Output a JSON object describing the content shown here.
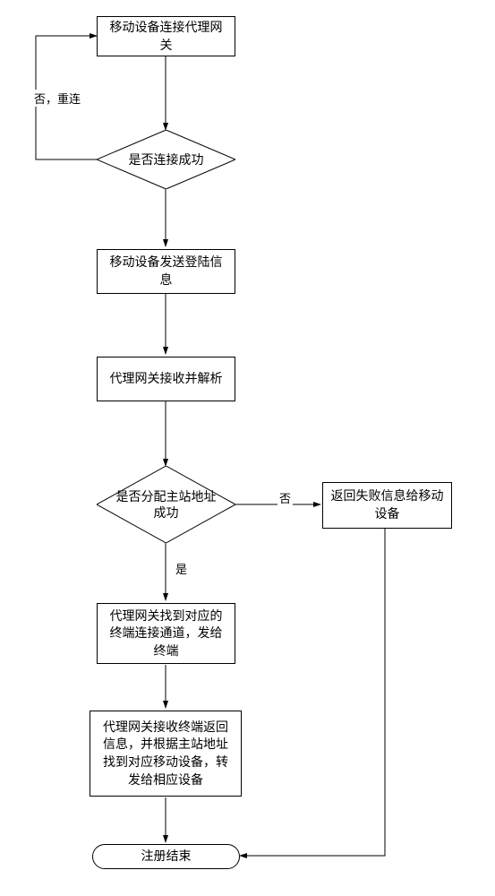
{
  "chart_data": {
    "type": "flowchart",
    "nodes": [
      {
        "id": "n1",
        "type": "process",
        "text": "移动设备连接代理网关"
      },
      {
        "id": "d1",
        "type": "decision",
        "text": "是否连接成功"
      },
      {
        "id": "n2",
        "type": "process",
        "text": "移动设备发送登陆信息"
      },
      {
        "id": "n3",
        "type": "process",
        "text": "代理网关接收并解析"
      },
      {
        "id": "d2",
        "type": "decision",
        "text": "是否分配主站地址成功"
      },
      {
        "id": "n4",
        "type": "process",
        "text": "返回失败信息给移动设备"
      },
      {
        "id": "n5",
        "type": "process",
        "text": "代理网关找到对应的终端连接通道，发给终端"
      },
      {
        "id": "n6",
        "type": "process",
        "text": "代理网关接收终端返回信息，并根据主站地址找到对应移动设备，转发给相应设备"
      },
      {
        "id": "end",
        "type": "terminator",
        "text": "注册结束"
      }
    ],
    "edges": [
      {
        "from": "n1",
        "to": "d1",
        "label": ""
      },
      {
        "from": "d1",
        "to": "n1",
        "label": "否，重连"
      },
      {
        "from": "d1",
        "to": "n2",
        "label": ""
      },
      {
        "from": "n2",
        "to": "n3",
        "label": ""
      },
      {
        "from": "n3",
        "to": "d2",
        "label": ""
      },
      {
        "from": "d2",
        "to": "n4",
        "label": "否"
      },
      {
        "from": "d2",
        "to": "n5",
        "label": "是"
      },
      {
        "from": "n5",
        "to": "n6",
        "label": ""
      },
      {
        "from": "n6",
        "to": "end",
        "label": ""
      },
      {
        "from": "n4",
        "to": "end",
        "label": ""
      }
    ],
    "edge_labels": {
      "no_reconnect": "否，重连",
      "no": "否",
      "yes": "是"
    }
  }
}
